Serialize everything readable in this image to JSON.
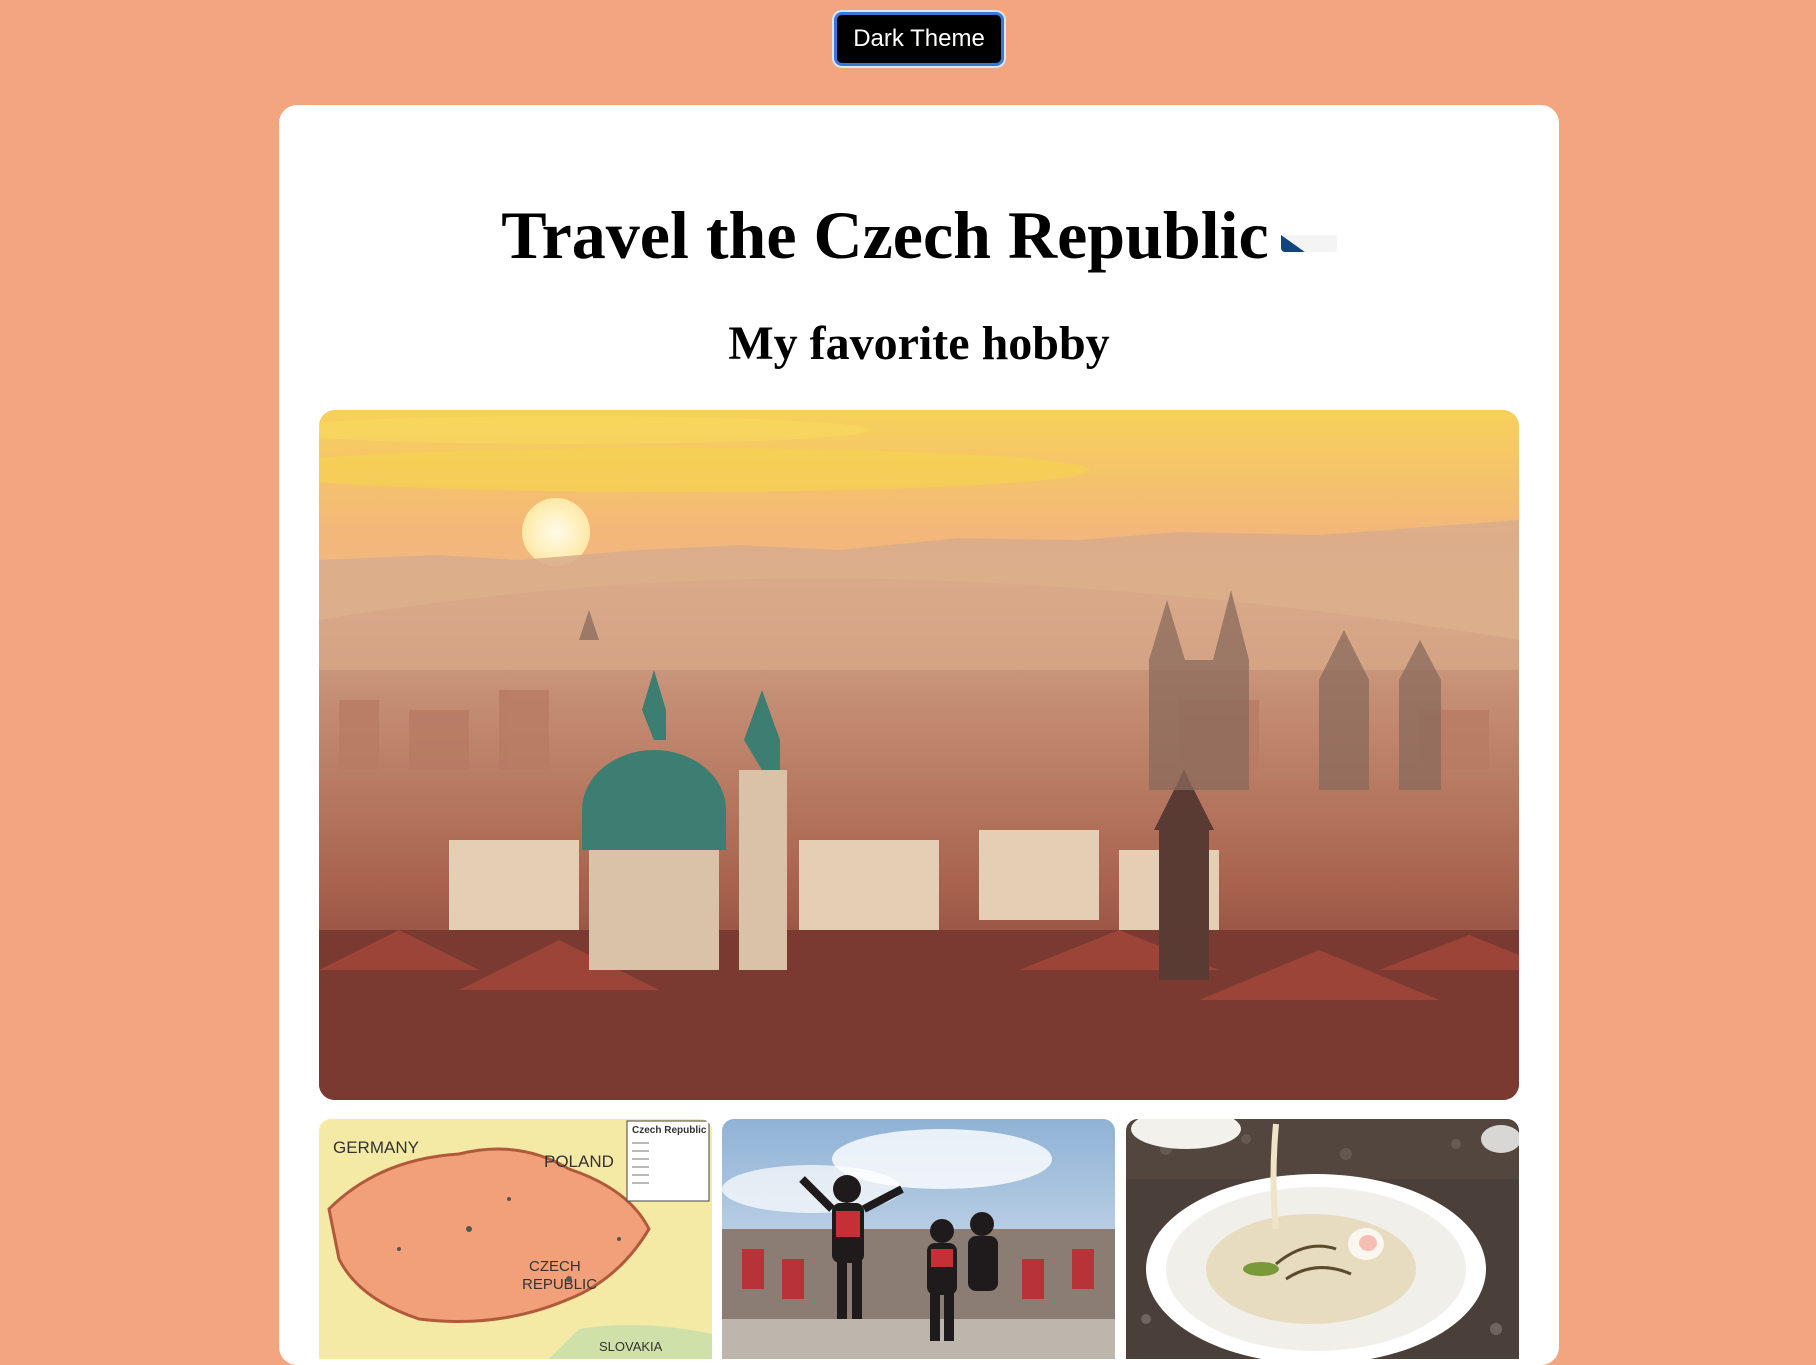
{
  "theme_button": {
    "label": "Dark Theme"
  },
  "page": {
    "title": "Travel the Czech Republic",
    "subtitle": "My favorite hobby"
  },
  "map": {
    "legend_title": "Czech Republic",
    "countries": [
      "GERMANY",
      "POLAND",
      "CZECH",
      "REPUBLIC",
      "SLOVAKIA"
    ]
  },
  "colors": {
    "background": "#f2a57f",
    "card": "#ffffff",
    "button_bg": "#000000",
    "button_border": "#3a78d8"
  }
}
